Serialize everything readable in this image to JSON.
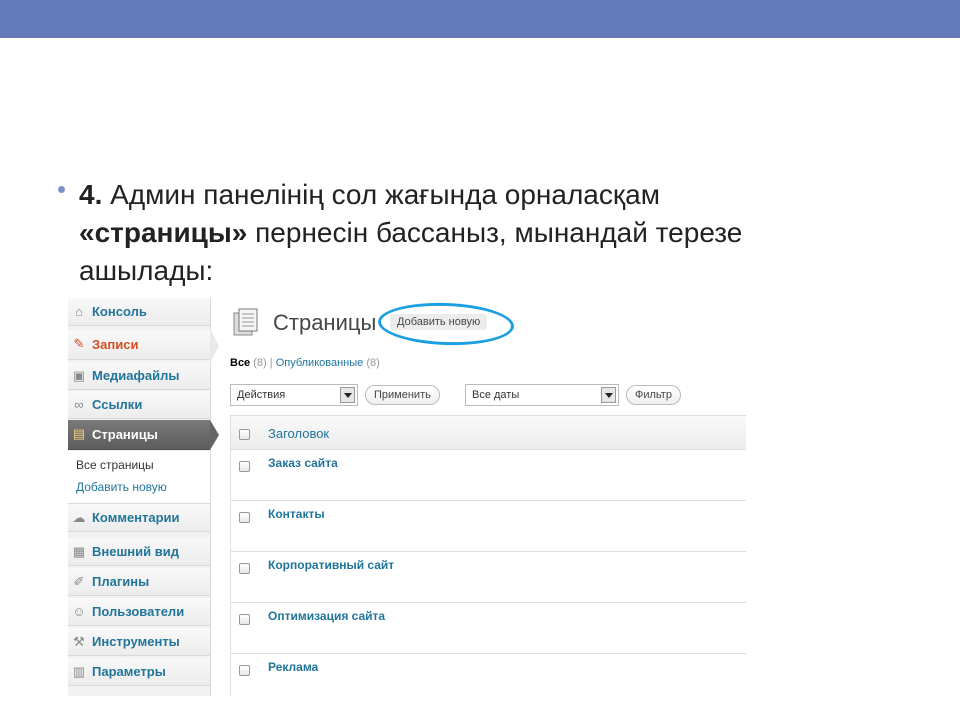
{
  "slide": {
    "number": "4.",
    "text_before": " Админ панелінің сол жағында орналасқам ",
    "bold_term": "«страницы»",
    "text_after": " пернесін бассаныз, мынандай терезе ашылады:"
  },
  "sidebar": {
    "items": [
      {
        "label": "Консоль",
        "icon": "home-icon"
      },
      {
        "label": "Записи",
        "icon": "pin-icon"
      },
      {
        "label": "Медиафайлы",
        "icon": "media-icon"
      },
      {
        "label": "Ссылки",
        "icon": "link-icon"
      },
      {
        "label": "Страницы",
        "icon": "pages-icon"
      },
      {
        "label": "Комментарии",
        "icon": "comment-icon"
      },
      {
        "label": "Внешний вид",
        "icon": "appearance-icon"
      },
      {
        "label": "Плагины",
        "icon": "plugin-icon"
      },
      {
        "label": "Пользователи",
        "icon": "users-icon"
      },
      {
        "label": "Инструменты",
        "icon": "tools-icon"
      },
      {
        "label": "Параметры",
        "icon": "settings-icon"
      }
    ],
    "submenu": [
      "Все страницы",
      "Добавить новую"
    ]
  },
  "main": {
    "title": "Страницы",
    "add_new": "Добавить новую",
    "views": {
      "all": "Все",
      "all_count": "(8)",
      "sep": "|",
      "published": "Опубликованные",
      "published_count": "(8)"
    },
    "bulk_actions": "Действия",
    "apply": "Применить",
    "dates": "Все даты",
    "filter": "Фильтр",
    "column_title": "Заголовок",
    "rows": [
      "Заказ сайта",
      "Контакты",
      "Корпоративный сайт",
      "Оптимизация сайта",
      "Реклама"
    ]
  },
  "colors": {
    "topbar": "#6479b8",
    "link": "#21759b",
    "highlight_circle": "#1a9fe2"
  }
}
